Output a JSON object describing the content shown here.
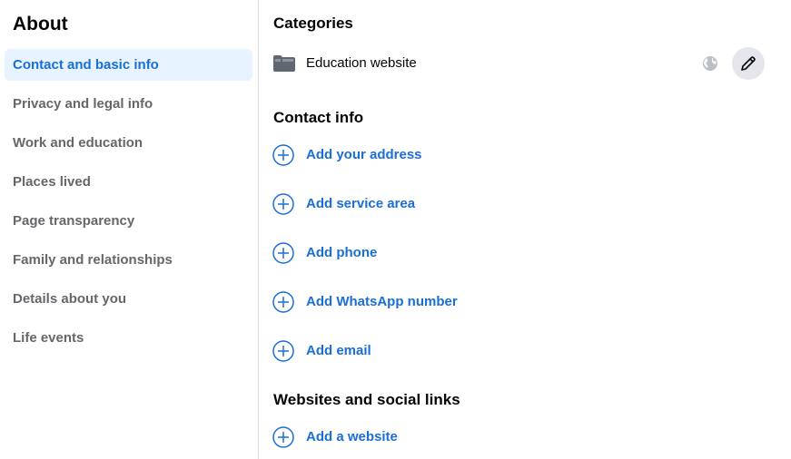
{
  "sidebar": {
    "title": "About",
    "items": [
      {
        "label": "Contact and basic info",
        "active": true
      },
      {
        "label": "Privacy and legal info"
      },
      {
        "label": "Work and education"
      },
      {
        "label": "Places lived"
      },
      {
        "label": "Page transparency"
      },
      {
        "label": "Family and relationships"
      },
      {
        "label": "Details about you"
      },
      {
        "label": "Life events"
      }
    ]
  },
  "categories": {
    "title": "Categories",
    "item": {
      "label": "Education website",
      "icon": "folder-icon",
      "privacy_icon": "globe-icon",
      "edit_icon": "pencil-icon"
    }
  },
  "contact_info": {
    "title": "Contact info",
    "actions": [
      {
        "label": "Add your address"
      },
      {
        "label": "Add service area"
      },
      {
        "label": "Add phone"
      },
      {
        "label": "Add WhatsApp number"
      },
      {
        "label": "Add email"
      }
    ]
  },
  "websites": {
    "title": "Websites and social links",
    "actions": [
      {
        "label": "Add a website"
      }
    ]
  },
  "colors": {
    "accent": "#1a6ed8",
    "active_bg": "#e7f3ff",
    "muted_text": "#65676b",
    "divider": "#dadde1",
    "button_bg": "#e4e6eb"
  }
}
